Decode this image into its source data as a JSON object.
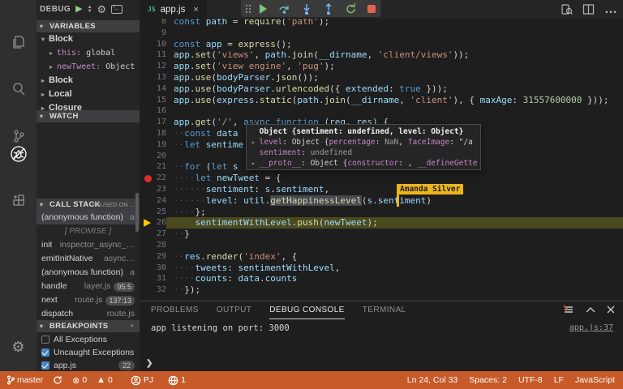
{
  "colors": {
    "status_bar": "#c65a28",
    "breakpoint": "#e02b2b",
    "current_line_highlight": "#4b4a1f",
    "collab_badge": "#edb41e",
    "keyword": "#569cd6",
    "variable": "#9cdcfe",
    "function": "#dcdcaa",
    "string": "#ce9178",
    "number": "#b5cea8"
  },
  "activity_bar": {
    "items": [
      "explorer-icon",
      "search-icon",
      "source-control-icon",
      "debug-icon",
      "extensions-icon"
    ],
    "active": "debug-icon",
    "bottom": "settings-gear-icon"
  },
  "sidebar": {
    "title": "DEBUG",
    "variables": {
      "header": "VARIABLES",
      "items": [
        {
          "arrow": "▾",
          "label": "Block",
          "kind": "scope"
        },
        {
          "arrow": "▸",
          "name": "this",
          "value": "global",
          "kind": "var"
        },
        {
          "arrow": "▸",
          "name": "newTweet",
          "value": "Object {sent_",
          "kind": "var"
        },
        {
          "arrow": "▸",
          "label": "Block",
          "kind": "scope"
        },
        {
          "arrow": "▸",
          "label": "Local",
          "kind": "scope"
        },
        {
          "arrow": "▸",
          "label": "Closure",
          "kind": "scope"
        }
      ]
    },
    "watch": {
      "header": "WATCH"
    },
    "call_stack": {
      "header": "CALL STACK",
      "paused_note": "PAUSED ON ...",
      "frames": [
        {
          "name": "(anonymous function)",
          "loc": "a",
          "selected": true
        },
        {
          "promise": "[ PROMISE ]"
        },
        {
          "name": "init",
          "loc": "inspector_async_…"
        },
        {
          "name": "emitInitNative",
          "loc": "async…"
        },
        {
          "name": "(anonymous function)",
          "loc": "a"
        },
        {
          "name": "handle",
          "loc": "layer.js",
          "badge": "95:5"
        },
        {
          "name": "next",
          "loc": "route.js",
          "badge": "137:13"
        },
        {
          "name": "dispatch",
          "loc": "route.js"
        }
      ]
    },
    "breakpoints": {
      "header": "BREAKPOINTS",
      "add_label": "+",
      "items": [
        {
          "checked": false,
          "label": "All Exceptions"
        },
        {
          "checked": true,
          "label": "Uncaught Exceptions"
        },
        {
          "checked": true,
          "label": "app.js",
          "badge": "22"
        }
      ]
    }
  },
  "tab": {
    "icon": "JS",
    "label": "app.js",
    "close": "×"
  },
  "debug_toolbar": {
    "buttons": [
      "continue",
      "step-over",
      "step-into",
      "step-out",
      "restart",
      "stop"
    ]
  },
  "editor": {
    "current_line": 26,
    "breakpoint_line": 22,
    "lines": [
      {
        "n": 8,
        "t": [
          [
            "k",
            "const"
          ],
          [
            "p",
            " "
          ],
          [
            "v",
            "path"
          ],
          [
            "p",
            " = "
          ],
          [
            "f",
            "require"
          ],
          [
            "p",
            "("
          ],
          [
            "s",
            "'path'"
          ],
          [
            "p",
            ");"
          ]
        ]
      },
      {
        "n": 9,
        "t": []
      },
      {
        "n": 10,
        "t": [
          [
            "k",
            "const"
          ],
          [
            "p",
            " "
          ],
          [
            "v",
            "app"
          ],
          [
            "p",
            " = "
          ],
          [
            "f",
            "express"
          ],
          [
            "p",
            "();"
          ]
        ]
      },
      {
        "n": 11,
        "t": [
          [
            "v",
            "app"
          ],
          [
            "p",
            "."
          ],
          [
            "f",
            "set"
          ],
          [
            "p",
            "("
          ],
          [
            "s",
            "'views'"
          ],
          [
            "p",
            ", "
          ],
          [
            "v",
            "path"
          ],
          [
            "p",
            "."
          ],
          [
            "f",
            "join"
          ],
          [
            "p",
            "("
          ],
          [
            "v",
            "__dirname"
          ],
          [
            "p",
            ", "
          ],
          [
            "s",
            "'client/views'"
          ],
          [
            "p",
            "));"
          ]
        ]
      },
      {
        "n": 12,
        "t": [
          [
            "v",
            "app"
          ],
          [
            "p",
            "."
          ],
          [
            "f",
            "set"
          ],
          [
            "p",
            "("
          ],
          [
            "s",
            "'view engine'"
          ],
          [
            "p",
            ", "
          ],
          [
            "s",
            "'pug'"
          ],
          [
            "p",
            ");"
          ]
        ]
      },
      {
        "n": 13,
        "t": [
          [
            "v",
            "app"
          ],
          [
            "p",
            "."
          ],
          [
            "f",
            "use"
          ],
          [
            "p",
            "("
          ],
          [
            "v",
            "bodyParser"
          ],
          [
            "p",
            "."
          ],
          [
            "f",
            "json"
          ],
          [
            "p",
            "());"
          ]
        ]
      },
      {
        "n": 14,
        "t": [
          [
            "v",
            "app"
          ],
          [
            "p",
            "."
          ],
          [
            "f",
            "use"
          ],
          [
            "p",
            "("
          ],
          [
            "v",
            "bodyParser"
          ],
          [
            "p",
            "."
          ],
          [
            "f",
            "urlencoded"
          ],
          [
            "p",
            "({ "
          ],
          [
            "v",
            "extended"
          ],
          [
            "p",
            ": "
          ],
          [
            "k",
            "true"
          ],
          [
            "p",
            " }));"
          ]
        ]
      },
      {
        "n": 15,
        "t": [
          [
            "v",
            "app"
          ],
          [
            "p",
            "."
          ],
          [
            "f",
            "use"
          ],
          [
            "p",
            "("
          ],
          [
            "v",
            "express"
          ],
          [
            "p",
            "."
          ],
          [
            "f",
            "static"
          ],
          [
            "p",
            "("
          ],
          [
            "v",
            "path"
          ],
          [
            "p",
            "."
          ],
          [
            "f",
            "join"
          ],
          [
            "p",
            "("
          ],
          [
            "v",
            "__dirname"
          ],
          [
            "p",
            ", "
          ],
          [
            "s",
            "'client'"
          ],
          [
            "p",
            "), { "
          ],
          [
            "v",
            "maxAge"
          ],
          [
            "p",
            ": "
          ],
          [
            "n",
            "31557600000"
          ],
          [
            "p",
            " }));"
          ]
        ]
      },
      {
        "n": 16,
        "t": []
      },
      {
        "n": 17,
        "t": [
          [
            "v",
            "app"
          ],
          [
            "p",
            "."
          ],
          [
            "f",
            "get"
          ],
          [
            "p",
            "("
          ],
          [
            "s",
            "'/'"
          ],
          [
            "p",
            ", "
          ],
          [
            "k",
            "async"
          ],
          [
            "p",
            " "
          ],
          [
            "k",
            "function"
          ],
          [
            "p",
            " ("
          ],
          [
            "v",
            "req"
          ],
          [
            "p",
            ", "
          ],
          [
            "v",
            "res"
          ],
          [
            "p",
            ") {"
          ]
        ]
      },
      {
        "n": 18,
        "t": [
          [
            "w",
            "··"
          ],
          [
            "k",
            "const"
          ],
          [
            "p",
            " "
          ],
          [
            "v",
            "data"
          ]
        ]
      },
      {
        "n": 19,
        "t": [
          [
            "w",
            "··"
          ],
          [
            "k",
            "let"
          ],
          [
            "p",
            " "
          ],
          [
            "v",
            "sentime"
          ]
        ]
      },
      {
        "n": 20,
        "t": []
      },
      {
        "n": 21,
        "t": [
          [
            "w",
            "··"
          ],
          [
            "k",
            "for"
          ],
          [
            "p",
            " ("
          ],
          [
            "k",
            "let"
          ],
          [
            "p",
            " "
          ],
          [
            "v",
            "s"
          ]
        ]
      },
      {
        "n": 22,
        "t": [
          [
            "w",
            "····"
          ],
          [
            "k",
            "let"
          ],
          [
            "p",
            " "
          ],
          [
            "v",
            "newTweet"
          ],
          [
            "p",
            " = {"
          ]
        ]
      },
      {
        "n": 23,
        "t": [
          [
            "w",
            "······"
          ],
          [
            "v",
            "sentiment"
          ],
          [
            "p",
            ": "
          ],
          [
            "v",
            "s"
          ],
          [
            "p",
            "."
          ],
          [
            "v",
            "sentiment"
          ],
          [
            "p",
            ","
          ]
        ]
      },
      {
        "n": 24,
        "t": [
          [
            "w",
            "······"
          ],
          [
            "v",
            "level"
          ],
          [
            "p",
            ": "
          ],
          [
            "v",
            "util"
          ],
          [
            "p",
            "."
          ],
          [
            "fs",
            "getHappinessLevel"
          ],
          [
            "p",
            "("
          ],
          [
            "v",
            "s"
          ],
          [
            "p",
            "."
          ],
          [
            "v",
            "sentiment"
          ],
          [
            "p",
            ")"
          ]
        ]
      },
      {
        "n": 25,
        "t": [
          [
            "w",
            "····"
          ],
          [
            "p",
            "};"
          ]
        ]
      },
      {
        "n": 26,
        "t": [
          [
            "w",
            "····"
          ],
          [
            "v",
            "sentimentWithLevel"
          ],
          [
            "p",
            "."
          ],
          [
            "f",
            "push"
          ],
          [
            "p",
            "("
          ],
          [
            "v",
            "newTweet"
          ],
          [
            "p",
            ");"
          ]
        ]
      },
      {
        "n": 27,
        "t": [
          [
            "w",
            "··"
          ],
          [
            "p",
            "}"
          ]
        ]
      },
      {
        "n": 28,
        "t": []
      },
      {
        "n": 29,
        "t": [
          [
            "w",
            "··"
          ],
          [
            "v",
            "res"
          ],
          [
            "p",
            "."
          ],
          [
            "f",
            "render"
          ],
          [
            "p",
            "("
          ],
          [
            "s",
            "'index'"
          ],
          [
            "p",
            ", {"
          ]
        ]
      },
      {
        "n": 30,
        "t": [
          [
            "w",
            "····"
          ],
          [
            "v",
            "tweets"
          ],
          [
            "p",
            ": "
          ],
          [
            "v",
            "sentimentWithLevel"
          ],
          [
            "p",
            ","
          ]
        ]
      },
      {
        "n": 31,
        "t": [
          [
            "w",
            "····"
          ],
          [
            "v",
            "counts"
          ],
          [
            "p",
            ": "
          ],
          [
            "v",
            "data"
          ],
          [
            "p",
            "."
          ],
          [
            "v",
            "counts"
          ]
        ]
      },
      {
        "n": 32,
        "t": [
          [
            "w",
            "··"
          ],
          [
            "p",
            "});"
          ]
        ]
      }
    ]
  },
  "tooltip": {
    "rows": [
      [
        [
          "ta",
          "  "
        ],
        [
          "tb",
          "Object {sentiment: undefined, level: Object}"
        ]
      ],
      [
        [
          "ta",
          "▸ "
        ],
        [
          "tn",
          "level"
        ],
        [
          "tv",
          ": Object {"
        ],
        [
          "tn",
          "percentage"
        ],
        [
          "tv",
          ": "
        ],
        [
          "td",
          "NaN"
        ],
        [
          "tv",
          ", "
        ],
        [
          "tn",
          "faceImage"
        ],
        [
          "tv",
          ": \"/a"
        ]
      ],
      [
        [
          "ta",
          "  "
        ],
        [
          "tn",
          "sentiment"
        ],
        [
          "tv",
          ": "
        ],
        [
          "td",
          "undefined"
        ]
      ],
      [
        [
          "ta",
          "▸ "
        ],
        [
          "tn",
          "__proto__"
        ],
        [
          "tv",
          ": Object {"
        ],
        [
          "tn",
          "constructor"
        ],
        [
          "tv",
          ": , "
        ],
        [
          "tn",
          "__defineGette"
        ]
      ]
    ]
  },
  "collab": {
    "label": "Amanda Silver"
  },
  "panel": {
    "tabs": [
      "PROBLEMS",
      "OUTPUT",
      "DEBUG CONSOLE",
      "TERMINAL"
    ],
    "active_tab": "DEBUG CONSOLE",
    "console_line": "app listening on port: 3000",
    "source_link": "app.js:37",
    "prompt": "❯"
  },
  "status_bar": {
    "branch": "master",
    "errors": "0",
    "warnings": "0",
    "share_user": "PJ",
    "participants": "1",
    "line_col": "Ln 24, Col 33",
    "spaces": "Spaces: 2",
    "encoding": "UTF-8",
    "eol": "LF",
    "language": "JavaScript"
  }
}
